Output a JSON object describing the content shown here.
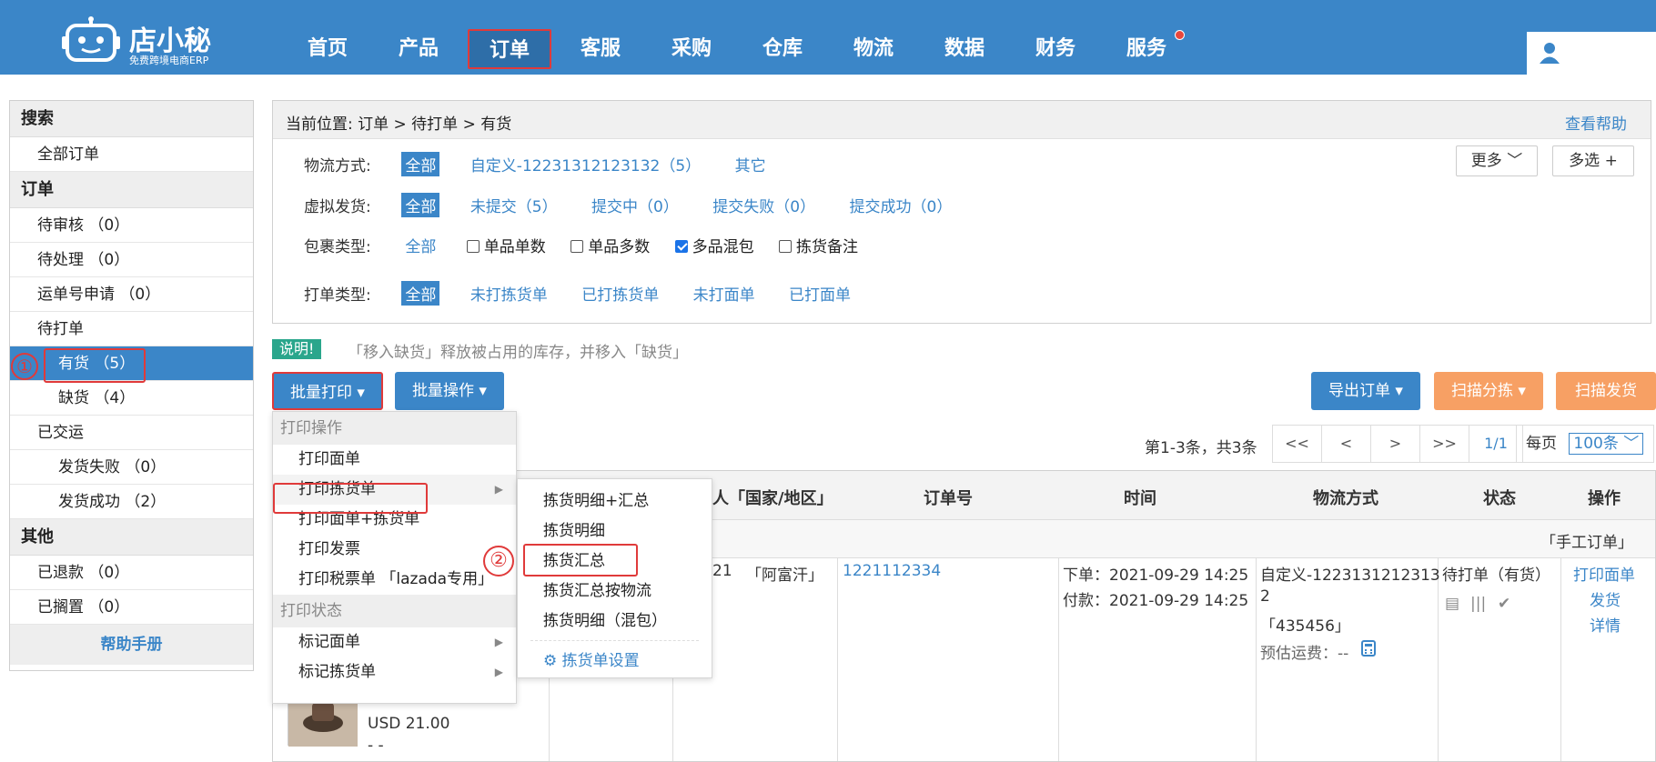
{
  "brand": {
    "name": "店小秘",
    "slogan": "免费跨境电商ERP"
  },
  "nav": {
    "items": [
      "首页",
      "产品",
      "订单",
      "客服",
      "采购",
      "仓库",
      "物流",
      "数据",
      "财务",
      "服务"
    ],
    "active": "订单"
  },
  "sidebar": {
    "search_head": "搜索",
    "all_orders": "全部订单",
    "order_head": "订单",
    "pending_review": "待审核 （0）",
    "pending_process": "待处理 （0）",
    "waybill_apply": "运单号申请 （0）",
    "to_print": "待打单",
    "in_stock": "有货 （5）",
    "out_of_stock": "缺货 （4）",
    "shipped": "已交运",
    "ship_failed": "发货失败 （0）",
    "ship_success": "发货成功 （2）",
    "other_head": "其他",
    "refunded": "已退款 （0）",
    "on_hold": "已搁置 （0）",
    "help_manual": "帮助手册"
  },
  "annotations": {
    "one": "①",
    "two": "②"
  },
  "filter": {
    "breadcrumb": "当前位置:  订单 > 待打单 > 有货",
    "help": "查看帮助",
    "logistics_label": "物流方式:",
    "logistics_all": "全部",
    "logistics_custom": "自定义-12231312123132（5）",
    "logistics_other": "其它",
    "virtual_label": "虚拟发货:",
    "virtual_all": "全部",
    "virtual_unsubmitted": "未提交（5）",
    "virtual_submitting": "提交中（0）",
    "virtual_failed": "提交失败（0）",
    "virtual_success": "提交成功（0）",
    "package_label": "包裹类型:",
    "package_all": "全部",
    "pkg_single_single": "单品单数",
    "pkg_single_multi": "单品多数",
    "pkg_multi_mixed": "多品混包",
    "pkg_pick_note": "拣货备注",
    "print_label": "打单类型:",
    "print_all": "全部",
    "print_unpicked": "未打拣货单",
    "print_picked": "已打拣货单",
    "print_unlabel": "未打面单",
    "print_label_done": "已打面单",
    "more": "更多",
    "multi": "多选 +"
  },
  "note": {
    "tag": "说明!",
    "text": "「移入缺货」释放被占用的库存，并移入「缺货」"
  },
  "actions": {
    "batch_print": "批量打印 ▾",
    "batch_op": "批量操作 ▾",
    "export": "导出订单 ▾",
    "scan_sort": "扫描分拣 ▾",
    "scan_ship": "扫描发货"
  },
  "pager": {
    "info": "第1-3条，共3条",
    "first": "<<",
    "prev": "<",
    "next": ">",
    "last": ">>",
    "page": "1/1",
    "per_page_label": "每页",
    "per_page_value": "100条"
  },
  "table": {
    "col_recipient": "人「国家/地区」",
    "col_order_no": "订单号",
    "col_time": "时间",
    "col_logistics": "物流方式",
    "col_status": "状态",
    "col_ops": "操作",
    "manual_tag": "「手工订单」",
    "row": {
      "recipient_frag": "21",
      "country": "「阿富汗」",
      "order_no": "1221112334",
      "order_time": "下单：2021-09-29 14:25",
      "pay_time": "付款：2021-09-29 14:25",
      "logistics_1": "自定义-1223131212313",
      "logistics_2": "2",
      "logistics_code": "「435456」",
      "est_fee": "预估运费：--",
      "status": "待打单（有货）",
      "op_print": "打印面单",
      "op_ship": "发货",
      "op_detail": "详情",
      "price": "USD 21.00",
      "dashes": "- -"
    }
  },
  "menu": {
    "head_print_ops": "打印操作",
    "print_label": "打印面单",
    "print_pick": "打印拣货单",
    "print_label_pick": "打印面单+拣货单",
    "print_invoice": "打印发票",
    "print_tax": "打印税票单 「lazada专用」",
    "head_print_status": "打印状态",
    "mark_label": "标记面单",
    "mark_pick": "标记拣货单"
  },
  "submenu": {
    "detail_summary": "拣货明细+汇总",
    "detail": "拣货明细",
    "summary": "拣货汇总",
    "summary_by_logistics": "拣货汇总按物流",
    "detail_mixed": "拣货明细（混包）",
    "settings": "拣货单设置"
  },
  "colors": {
    "primary": "#3b86c8",
    "orange": "#f7a064",
    "highlight": "#e03a3a",
    "note_green": "#2aa68c"
  }
}
